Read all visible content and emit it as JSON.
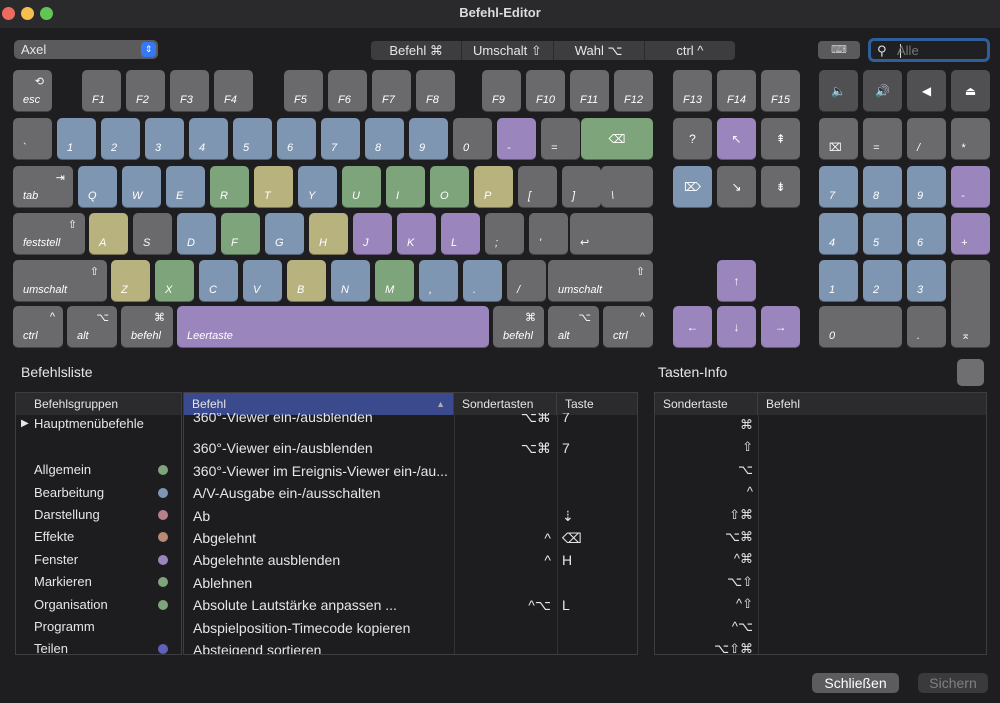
{
  "window": {
    "title": "Befehl-Editor"
  },
  "colors": {
    "blue": "#7f96b2",
    "purple": "#9a86bd",
    "green": "#7ea47b",
    "yellow": "#b8b27f",
    "gray": "#6a6a6c",
    "accent": "#3478f6",
    "list_header_selected": "#3a4a8c"
  },
  "toolbar": {
    "preset": "Axel",
    "modifiers": [
      "Befehl ⌘",
      "Umschalt ⇧",
      "Wahl ⌥",
      "ctrl ^"
    ],
    "keyboard_button": "⌨",
    "search_placeholder": "Alle"
  },
  "keyboard": {
    "fn_row": [
      {
        "label": "esc",
        "icon": "⟲"
      },
      {
        "label": "F1"
      },
      {
        "label": "F2"
      },
      {
        "label": "F3"
      },
      {
        "label": "F4"
      },
      {
        "label": "F5"
      },
      {
        "label": "F6"
      },
      {
        "label": "F7"
      },
      {
        "label": "F8"
      },
      {
        "label": "F9"
      },
      {
        "label": "F10"
      },
      {
        "label": "F11"
      },
      {
        "label": "F12"
      },
      {
        "label": "F13"
      },
      {
        "label": "F14"
      },
      {
        "label": "F15"
      }
    ],
    "media_keys": [
      "🔈",
      "🔊",
      "◀",
      "⏏"
    ],
    "num_row": [
      "`",
      "1",
      "2",
      "3",
      "4",
      "5",
      "6",
      "7",
      "8",
      "9",
      "0",
      "-",
      "=",
      "⌫"
    ],
    "q_row": [
      "tab",
      "Q",
      "W",
      "E",
      "R",
      "T",
      "Y",
      "U",
      "I",
      "O",
      "P",
      "[",
      "]",
      "\\"
    ],
    "a_row": [
      "feststell",
      "A",
      "S",
      "D",
      "F",
      "G",
      "H",
      "J",
      "K",
      "L",
      ";",
      "'",
      "↩"
    ],
    "z_row": [
      "umschalt",
      "Z",
      "X",
      "C",
      "V",
      "B",
      "N",
      "M",
      ",",
      ".",
      "/",
      "umschalt"
    ],
    "bottom_row": [
      "ctrl",
      "alt",
      "befehl",
      "Leertaste",
      "befehl",
      "alt",
      "ctrl"
    ],
    "tab_icon": "⇥",
    "shift_icon": "⇧",
    "caps_icon": "⇪",
    "cmd_icon": "⌘",
    "opt_icon": "⌥",
    "ctrl_icon": "^",
    "nav_keys": [
      "?",
      "↖",
      "⇞",
      "⌦",
      "↘",
      "⇟"
    ],
    "arrow_keys": [
      "↑",
      "←",
      "↓",
      "→"
    ],
    "numpad": [
      "⌧",
      "=",
      "/",
      "*",
      "7",
      "8",
      "9",
      "-",
      "4",
      "5",
      "6",
      "+",
      "1",
      "2",
      "3",
      "0",
      ".",
      "⌅"
    ]
  },
  "command_list": {
    "title": "Befehlsliste",
    "groups_header": "Befehlsgruppen",
    "groups": [
      {
        "name": "Hauptmenübefehle",
        "expandable": true,
        "marker": "▶"
      },
      {
        "name": "Allgemein",
        "color": "#7ea47b"
      },
      {
        "name": "Bearbeitung",
        "color": "#7f96b2"
      },
      {
        "name": "Darstellung",
        "color": "#b58088"
      },
      {
        "name": "Effekte",
        "color": "#b88a76"
      },
      {
        "name": "Fenster",
        "color": "#9a86bd"
      },
      {
        "name": "Markieren",
        "color": "#7ea47b"
      },
      {
        "name": "Organisation",
        "color": "#7ea47b"
      },
      {
        "name": "Programm",
        "color": ""
      },
      {
        "name": "Teilen",
        "color": "#5f62b8"
      }
    ],
    "columns": [
      "Befehl",
      "Sondertasten",
      "Taste"
    ],
    "sort_indicator": "▲",
    "commands": [
      {
        "name": "360°-Viewer ein-/ausblenden",
        "mods": "⌥⌘",
        "key": "7"
      },
      {
        "name": "360°-Viewer ein-/ausblenden",
        "mods": "⌥⌘",
        "key": "7"
      },
      {
        "name": "360°-Viewer im Ereignis-Viewer ein-/au...",
        "mods": "",
        "key": ""
      },
      {
        "name": "A/V-Ausgabe ein-/ausschalten",
        "mods": "",
        "key": ""
      },
      {
        "name": "Ab",
        "mods": "",
        "key": "⇣"
      },
      {
        "name": "Abgelehnt",
        "mods": "^",
        "key": "⌫"
      },
      {
        "name": "Abgelehnte ausblenden",
        "mods": "^",
        "key": "H"
      },
      {
        "name": "Ablehnen",
        "mods": "",
        "key": ""
      },
      {
        "name": "Absolute Lautstärke anpassen ...",
        "mods": "^⌥",
        "key": "L"
      },
      {
        "name": "Abspielposition-Timecode kopieren",
        "mods": "",
        "key": ""
      },
      {
        "name": "Absteigend sortieren",
        "mods": "",
        "key": ""
      }
    ]
  },
  "key_info": {
    "title": "Tasten-Info",
    "columns": [
      "Sondertaste",
      "Befehl"
    ],
    "rows": [
      "⌘",
      "⇧",
      "⌥",
      "^",
      "⇧⌘",
      "⌥⌘",
      "^⌘",
      "⌥⇧",
      "^⇧",
      "^⌥",
      "⌥⇧⌘"
    ]
  },
  "footer": {
    "close": "Schließen",
    "save": "Sichern"
  }
}
